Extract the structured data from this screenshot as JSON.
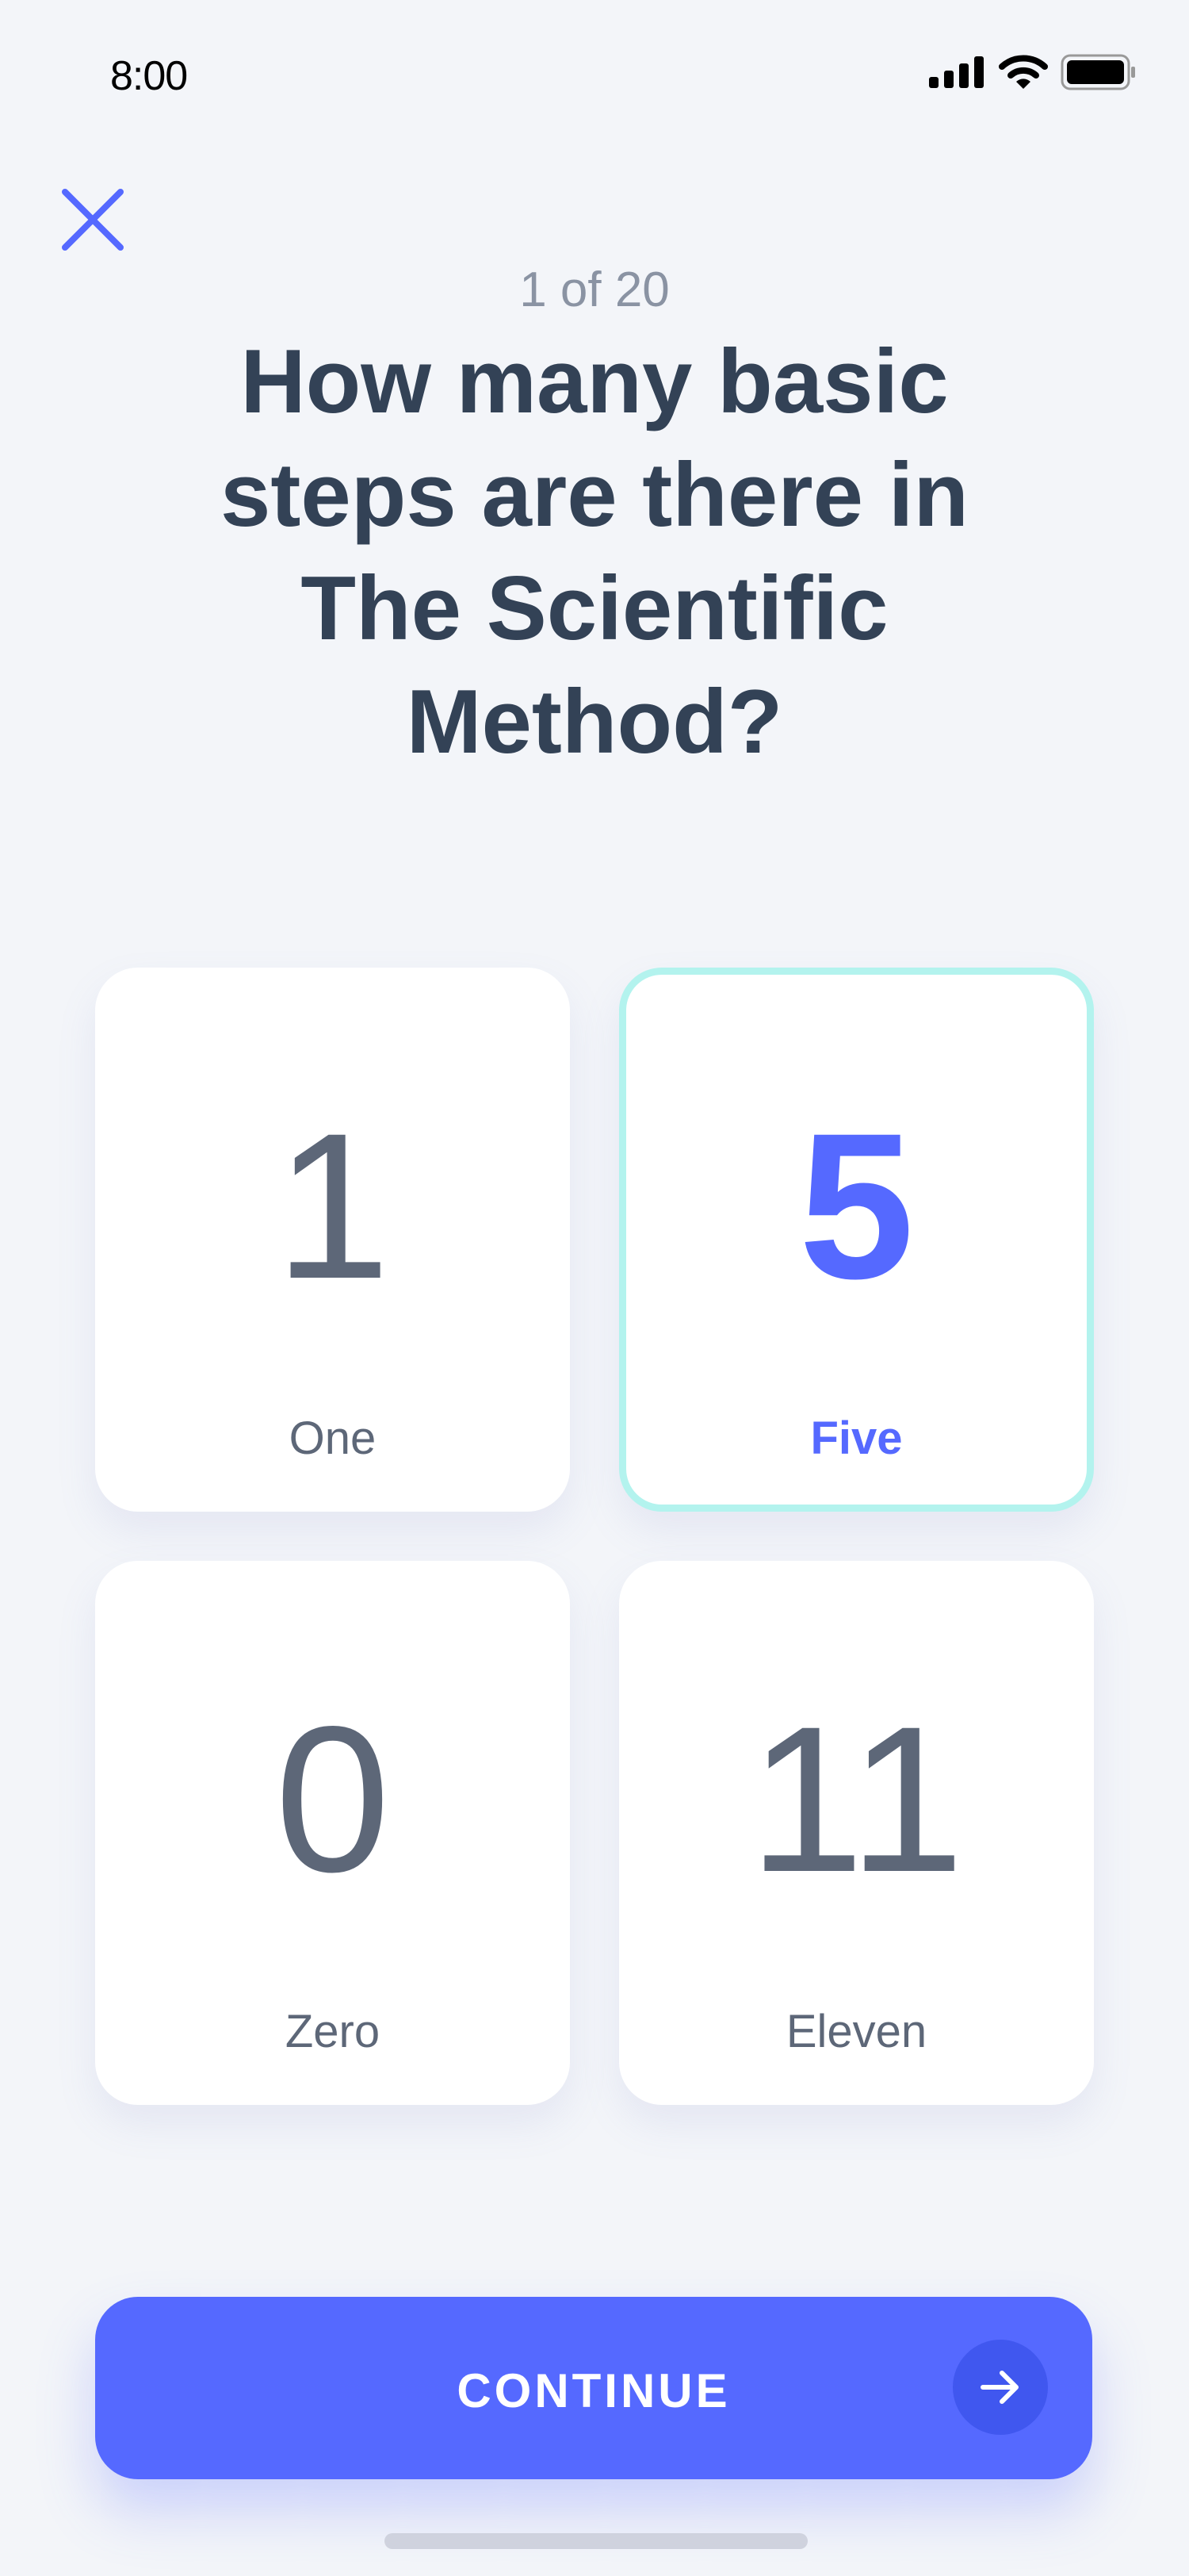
{
  "status_bar": {
    "time": "8:00",
    "icons": [
      "signal-icon",
      "wifi-icon",
      "battery-icon"
    ]
  },
  "header": {
    "close_icon": "close-icon",
    "progress": "1 of 20"
  },
  "question": "How many basic steps are there in The Scientific Method?",
  "options": [
    {
      "number": "1",
      "label": "One",
      "selected": false
    },
    {
      "number": "5",
      "label": "Five",
      "selected": true
    },
    {
      "number": "0",
      "label": "Zero",
      "selected": false
    },
    {
      "number": "11",
      "label": "Eleven",
      "selected": false
    }
  ],
  "continue_button": {
    "label": "CONTINUE",
    "icon": "arrow-right-icon"
  },
  "colors": {
    "accent": "#5569ff",
    "selected_border": "#b3f3ee",
    "text": "#334256",
    "background": "#f3f5f9"
  }
}
